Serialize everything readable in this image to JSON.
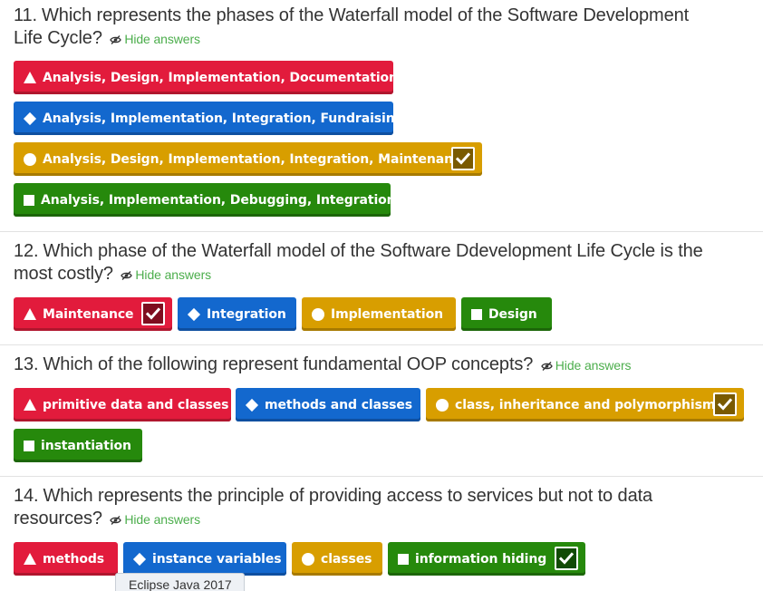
{
  "hide_label": "Hide answers",
  "colors": {
    "red": "#e21b3c",
    "blue": "#1368ce",
    "yellow": "#d89e00",
    "green": "#26890c",
    "link": "#4cae4c"
  },
  "questions": [
    {
      "number": "11.",
      "line1": "Which represents the phases of the Waterfall model of the Software Development",
      "line2": "Life Cycle?",
      "answers": [
        {
          "shape": "triangle-icon",
          "color": "red",
          "text": "Analysis, Design, Implementation, Documentation",
          "correct": false
        },
        {
          "shape": "diamond-icon",
          "color": "blue",
          "text": "Analysis, Implementation, Integration, Fundraising",
          "correct": false
        },
        {
          "shape": "circle-icon",
          "color": "yellow",
          "text": "Analysis, Design, Implementation, Integration, Maintenance",
          "correct": true
        },
        {
          "shape": "square-icon",
          "color": "green",
          "text": "Analysis, Implementation, Debugging, Integration",
          "correct": false
        }
      ]
    },
    {
      "number": "12.",
      "line1": "Which phase of the Waterfall model of the Software Ddevelopment Life Cycle is the",
      "line2": "most costly?",
      "answers": [
        {
          "shape": "triangle-icon",
          "color": "red",
          "text": "Maintenance",
          "correct": true
        },
        {
          "shape": "diamond-icon",
          "color": "blue",
          "text": "Integration",
          "correct": false
        },
        {
          "shape": "circle-icon",
          "color": "yellow",
          "text": "Implementation",
          "correct": false
        },
        {
          "shape": "square-icon",
          "color": "green",
          "text": "Design",
          "correct": false
        }
      ]
    },
    {
      "number": "13.",
      "line1": "Which of the following represent fundamental OOP concepts?",
      "line2": "",
      "answers": [
        {
          "shape": "triangle-icon",
          "color": "red",
          "text": "primitive data and classes",
          "correct": false
        },
        {
          "shape": "diamond-icon",
          "color": "blue",
          "text": "methods and classes",
          "correct": false
        },
        {
          "shape": "circle-icon",
          "color": "yellow",
          "text": "class, inheritance and polymorphism",
          "correct": true
        },
        {
          "shape": "square-icon",
          "color": "green",
          "text": "instantiation",
          "correct": false
        }
      ]
    },
    {
      "number": "14.",
      "line1": "Which represents the principle of providing access to services but not to data",
      "line2": "resources?",
      "answers": [
        {
          "shape": "triangle-icon",
          "color": "red",
          "text": "methods",
          "correct": false
        },
        {
          "shape": "diamond-icon",
          "color": "blue",
          "text": "instance variables",
          "correct": false
        },
        {
          "shape": "circle-icon",
          "color": "yellow",
          "text": "classes",
          "correct": false
        },
        {
          "shape": "square-icon",
          "color": "green",
          "text": "information hiding",
          "correct": true
        }
      ]
    }
  ],
  "tooltip": "Eclipse Java 2017"
}
